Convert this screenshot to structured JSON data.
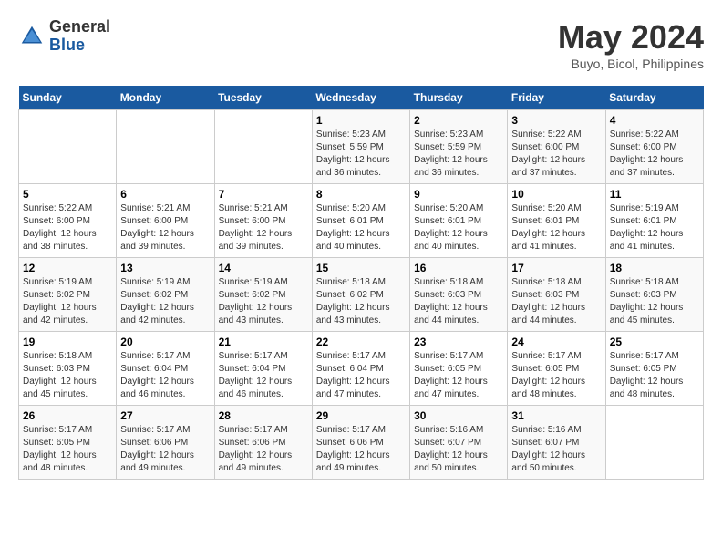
{
  "header": {
    "logo_general": "General",
    "logo_blue": "Blue",
    "month_year": "May 2024",
    "location": "Buyo, Bicol, Philippines"
  },
  "days_of_week": [
    "Sunday",
    "Monday",
    "Tuesday",
    "Wednesday",
    "Thursday",
    "Friday",
    "Saturday"
  ],
  "weeks": [
    [
      {
        "day": "",
        "info": ""
      },
      {
        "day": "",
        "info": ""
      },
      {
        "day": "",
        "info": ""
      },
      {
        "day": "1",
        "info": "Sunrise: 5:23 AM\nSunset: 5:59 PM\nDaylight: 12 hours and 36 minutes."
      },
      {
        "day": "2",
        "info": "Sunrise: 5:23 AM\nSunset: 5:59 PM\nDaylight: 12 hours and 36 minutes."
      },
      {
        "day": "3",
        "info": "Sunrise: 5:22 AM\nSunset: 6:00 PM\nDaylight: 12 hours and 37 minutes."
      },
      {
        "day": "4",
        "info": "Sunrise: 5:22 AM\nSunset: 6:00 PM\nDaylight: 12 hours and 37 minutes."
      }
    ],
    [
      {
        "day": "5",
        "info": "Sunrise: 5:22 AM\nSunset: 6:00 PM\nDaylight: 12 hours and 38 minutes."
      },
      {
        "day": "6",
        "info": "Sunrise: 5:21 AM\nSunset: 6:00 PM\nDaylight: 12 hours and 39 minutes."
      },
      {
        "day": "7",
        "info": "Sunrise: 5:21 AM\nSunset: 6:00 PM\nDaylight: 12 hours and 39 minutes."
      },
      {
        "day": "8",
        "info": "Sunrise: 5:20 AM\nSunset: 6:01 PM\nDaylight: 12 hours and 40 minutes."
      },
      {
        "day": "9",
        "info": "Sunrise: 5:20 AM\nSunset: 6:01 PM\nDaylight: 12 hours and 40 minutes."
      },
      {
        "day": "10",
        "info": "Sunrise: 5:20 AM\nSunset: 6:01 PM\nDaylight: 12 hours and 41 minutes."
      },
      {
        "day": "11",
        "info": "Sunrise: 5:19 AM\nSunset: 6:01 PM\nDaylight: 12 hours and 41 minutes."
      }
    ],
    [
      {
        "day": "12",
        "info": "Sunrise: 5:19 AM\nSunset: 6:02 PM\nDaylight: 12 hours and 42 minutes."
      },
      {
        "day": "13",
        "info": "Sunrise: 5:19 AM\nSunset: 6:02 PM\nDaylight: 12 hours and 42 minutes."
      },
      {
        "day": "14",
        "info": "Sunrise: 5:19 AM\nSunset: 6:02 PM\nDaylight: 12 hours and 43 minutes."
      },
      {
        "day": "15",
        "info": "Sunrise: 5:18 AM\nSunset: 6:02 PM\nDaylight: 12 hours and 43 minutes."
      },
      {
        "day": "16",
        "info": "Sunrise: 5:18 AM\nSunset: 6:03 PM\nDaylight: 12 hours and 44 minutes."
      },
      {
        "day": "17",
        "info": "Sunrise: 5:18 AM\nSunset: 6:03 PM\nDaylight: 12 hours and 44 minutes."
      },
      {
        "day": "18",
        "info": "Sunrise: 5:18 AM\nSunset: 6:03 PM\nDaylight: 12 hours and 45 minutes."
      }
    ],
    [
      {
        "day": "19",
        "info": "Sunrise: 5:18 AM\nSunset: 6:03 PM\nDaylight: 12 hours and 45 minutes."
      },
      {
        "day": "20",
        "info": "Sunrise: 5:17 AM\nSunset: 6:04 PM\nDaylight: 12 hours and 46 minutes."
      },
      {
        "day": "21",
        "info": "Sunrise: 5:17 AM\nSunset: 6:04 PM\nDaylight: 12 hours and 46 minutes."
      },
      {
        "day": "22",
        "info": "Sunrise: 5:17 AM\nSunset: 6:04 PM\nDaylight: 12 hours and 47 minutes."
      },
      {
        "day": "23",
        "info": "Sunrise: 5:17 AM\nSunset: 6:05 PM\nDaylight: 12 hours and 47 minutes."
      },
      {
        "day": "24",
        "info": "Sunrise: 5:17 AM\nSunset: 6:05 PM\nDaylight: 12 hours and 48 minutes."
      },
      {
        "day": "25",
        "info": "Sunrise: 5:17 AM\nSunset: 6:05 PM\nDaylight: 12 hours and 48 minutes."
      }
    ],
    [
      {
        "day": "26",
        "info": "Sunrise: 5:17 AM\nSunset: 6:05 PM\nDaylight: 12 hours and 48 minutes."
      },
      {
        "day": "27",
        "info": "Sunrise: 5:17 AM\nSunset: 6:06 PM\nDaylight: 12 hours and 49 minutes."
      },
      {
        "day": "28",
        "info": "Sunrise: 5:17 AM\nSunset: 6:06 PM\nDaylight: 12 hours and 49 minutes."
      },
      {
        "day": "29",
        "info": "Sunrise: 5:17 AM\nSunset: 6:06 PM\nDaylight: 12 hours and 49 minutes."
      },
      {
        "day": "30",
        "info": "Sunrise: 5:16 AM\nSunset: 6:07 PM\nDaylight: 12 hours and 50 minutes."
      },
      {
        "day": "31",
        "info": "Sunrise: 5:16 AM\nSunset: 6:07 PM\nDaylight: 12 hours and 50 minutes."
      },
      {
        "day": "",
        "info": ""
      }
    ]
  ]
}
